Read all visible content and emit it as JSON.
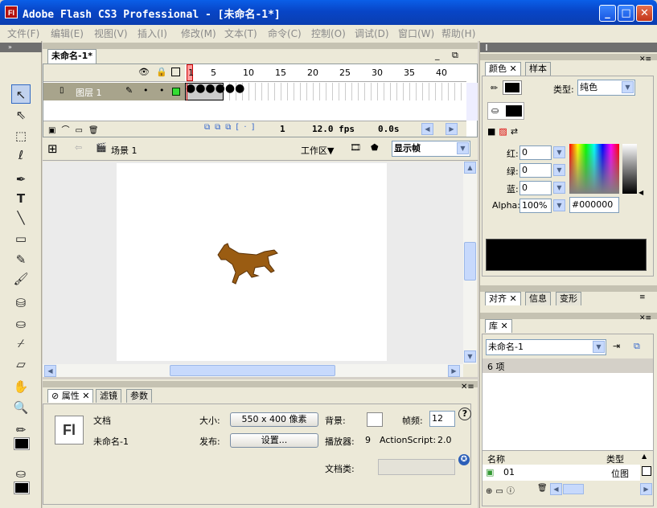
{
  "window": {
    "title": "Adobe Flash CS3 Professional - [未命名-1*]",
    "logo": "Fl"
  },
  "menu": [
    "文件(F)",
    "编辑(E)",
    "视图(V)",
    "插入(I)",
    "修改(M)",
    "文本(T)",
    "命令(C)",
    "控制(O)",
    "调试(D)",
    "窗口(W)",
    "帮助(H)"
  ],
  "doc_tab": "未命名-1*",
  "timeline": {
    "layer_name": "图层 1",
    "frame_numbers": [
      "1",
      "5",
      "10",
      "15",
      "20",
      "25",
      "30",
      "35",
      "40"
    ],
    "current_frame": "1",
    "fps": "12.0 fps",
    "time": "0.0s"
  },
  "editbar": {
    "scene": "场景 1",
    "workspace": "工作区▼",
    "zoom": "显示帧"
  },
  "props": {
    "tabs": [
      "属性",
      "滤镜",
      "参数"
    ],
    "type_label": "文档",
    "doc_name": "未命名-1",
    "size_label": "大小:",
    "size_value": "550 x 400 像素",
    "publish_label": "发布:",
    "publish_button": "设置...",
    "bg_label": "背景:",
    "fps_label": "帧频:",
    "fps_value": "12",
    "player_label": "播放器:",
    "player_value": "9",
    "as_label": "ActionScript:",
    "as_value": "2.0",
    "class_label": "文档类:",
    "logo": "Fl"
  },
  "color_panel": {
    "tabs": [
      "颜色",
      "样本"
    ],
    "type_label": "类型:",
    "type_value": "纯色",
    "red_label": "红:",
    "green_label": "绿:",
    "blue_label": "蓝:",
    "alpha_label": "Alpha:",
    "red": "0",
    "green": "0",
    "blue": "0",
    "alpha": "100%",
    "hex": "#000000",
    "stroke_color": "#000000",
    "fill_color": "#000000"
  },
  "align_panel": {
    "tabs": [
      "对齐",
      "信息",
      "变形"
    ]
  },
  "library": {
    "tab": "库",
    "doc_select": "未命名-1",
    "count": "6 项",
    "col_name": "名称",
    "col_type": "类型",
    "item_name": "01",
    "item_type": "位图"
  }
}
